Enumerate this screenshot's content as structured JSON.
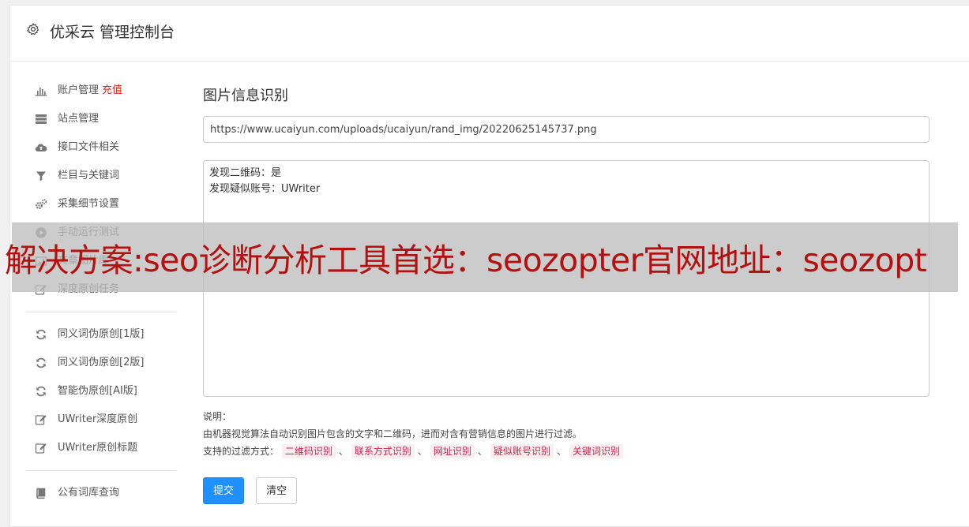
{
  "header": {
    "title": "优采云 管理控制台"
  },
  "sidebar": {
    "groups": [
      [
        {
          "label": "账户管理",
          "extra": "充值",
          "icon": "bar-chart-icon"
        },
        {
          "label": "站点管理",
          "icon": "server-icon"
        },
        {
          "label": "接口文件相关",
          "icon": "cloud-upload-icon"
        },
        {
          "label": "栏目与关键词",
          "icon": "filter-icon"
        },
        {
          "label": "采集细节设置",
          "icon": "gears-icon"
        },
        {
          "label": "手动运行测试",
          "icon": "play-circle-icon"
        },
        {
          "label": "文章图片库",
          "icon": "image-icon"
        },
        {
          "label": "深度原创任务",
          "icon": "edit-icon"
        }
      ],
      [
        {
          "label": "同义词伪原创[1版]",
          "icon": "refresh-icon"
        },
        {
          "label": "同义词伪原创[2版]",
          "icon": "refresh-icon"
        },
        {
          "label": "智能伪原创[AI版]",
          "icon": "refresh-icon"
        },
        {
          "label": "UWriter深度原创",
          "icon": "edit-icon"
        },
        {
          "label": "UWriter原创标题",
          "icon": "edit-icon"
        }
      ],
      [
        {
          "label": "公有词库查询",
          "icon": "book-icon"
        }
      ]
    ]
  },
  "main": {
    "title": "图片信息识别",
    "url_value": "https://www.ucaiyun.com/uploads/ucaiyun/rand_img/20220625145737.png",
    "result_lines": [
      "发现二维码：是",
      "发现疑似账号：UWriter"
    ],
    "notes": {
      "label": "说明：",
      "description": "由机器视觉算法自动识别图片包含的文字和二维码，进而对含有营销信息的图片进行过滤。",
      "filters_label": "支持的过滤方式：",
      "separator": "、",
      "filters": [
        "二维码识别",
        "联系方式识别",
        "网址识别",
        "疑似账号识别",
        "关键词识别"
      ]
    },
    "buttons": {
      "submit": "提交",
      "clear": "清空"
    }
  },
  "overlay": {
    "text": "解决方案:seo诊断分析工具首选：seozopter官网地址：seozopt"
  },
  "colors": {
    "primary": "#1e90ff",
    "recharge": "#d9261c",
    "tag_text": "#c7254e",
    "tag_bg": "#fbeef1",
    "overlay_text": "#b51010"
  }
}
